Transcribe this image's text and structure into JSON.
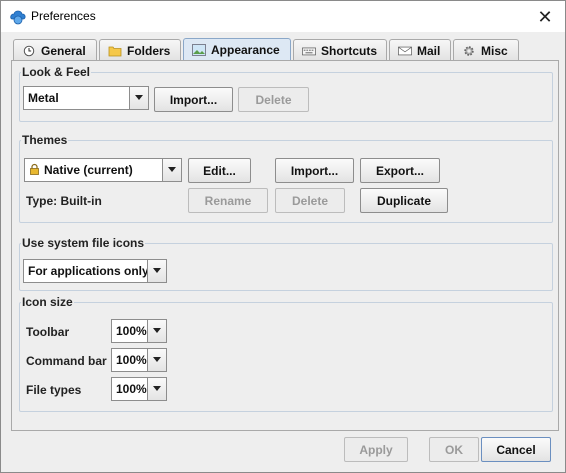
{
  "window": {
    "title": "Preferences"
  },
  "tabs": [
    {
      "label": "General",
      "icon": "clock-icon"
    },
    {
      "label": "Folders",
      "icon": "folder-icon"
    },
    {
      "label": "Appearance",
      "icon": "picture-icon",
      "active": true
    },
    {
      "label": "Shortcuts",
      "icon": "keyboard-icon"
    },
    {
      "label": "Mail",
      "icon": "envelope-icon"
    },
    {
      "label": "Misc",
      "icon": "gear-icon"
    }
  ],
  "look_and_feel": {
    "title": "Look & Feel",
    "selected": "Metal",
    "import_label": "Import...",
    "delete_label": "Delete"
  },
  "themes": {
    "title": "Themes",
    "selected": "Native (current)",
    "edit_label": "Edit...",
    "import_label": "Import...",
    "export_label": "Export...",
    "type_text": "Type: Built-in",
    "rename_label": "Rename",
    "delete_label": "Delete",
    "duplicate_label": "Duplicate"
  },
  "system_icons": {
    "title": "Use system file icons",
    "selected": "For applications only"
  },
  "icon_size": {
    "title": "Icon size",
    "rows": [
      {
        "label": "Toolbar",
        "value": "100%"
      },
      {
        "label": "Command bar",
        "value": "100%"
      },
      {
        "label": "File types",
        "value": "100%"
      }
    ]
  },
  "footer": {
    "apply_label": "Apply",
    "ok_label": "OK",
    "cancel_label": "Cancel"
  },
  "colors": {
    "active_tab": "#dde8f4",
    "group_border": "#c5d1de",
    "disabled_text": "#9a9a9a"
  }
}
